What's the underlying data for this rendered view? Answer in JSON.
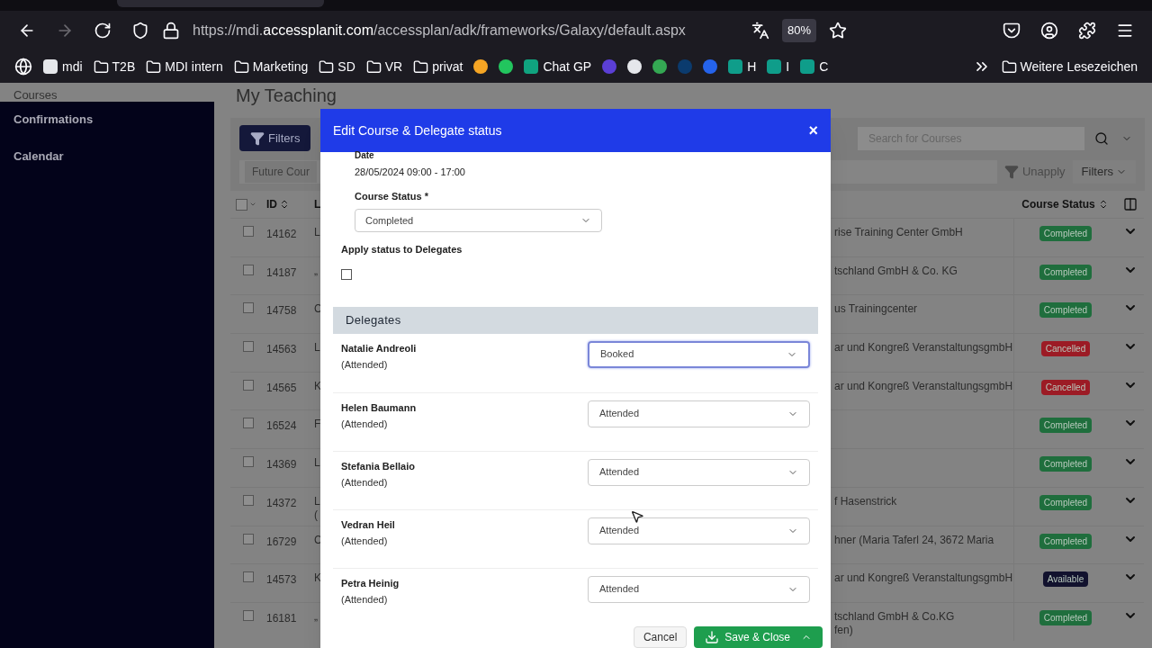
{
  "browser": {
    "url_start": "https://mdi.",
    "url_domain": "accessplanit.com",
    "url_path": "/accessplan/adk/frameworks/Galaxy/default.aspx",
    "zoom": "80%",
    "forward_disabled": true
  },
  "bookmarks": [
    {
      "kind": "site",
      "label": "mdi",
      "color": "#e5e7eb"
    },
    {
      "kind": "folder",
      "label": "T2B"
    },
    {
      "kind": "folder",
      "label": "MDI intern"
    },
    {
      "kind": "folder",
      "label": "Marketing"
    },
    {
      "kind": "folder",
      "label": "SD"
    },
    {
      "kind": "folder",
      "label": "VR"
    },
    {
      "kind": "folder",
      "label": "privat"
    },
    {
      "kind": "icon",
      "color": "#f5a524"
    },
    {
      "kind": "icon",
      "color": "#22c55e"
    },
    {
      "kind": "site",
      "label": "Chat GP",
      "color": "#10a37f"
    },
    {
      "kind": "icon",
      "color": "#5b3fd6"
    },
    {
      "kind": "icon",
      "color": "#e5e7eb"
    },
    {
      "kind": "icon",
      "color": "#34a853"
    },
    {
      "kind": "icon",
      "color": "#0b3b6e"
    },
    {
      "kind": "icon",
      "color": "#2563eb"
    },
    {
      "kind": "site",
      "label": "H",
      "color": "#0f9d8a"
    },
    {
      "kind": "site",
      "label": "I",
      "color": "#0f9d8a"
    },
    {
      "kind": "site",
      "label": "C",
      "color": "#0f9d8a"
    }
  ],
  "bookmarks_more": "Weitere Lesezeichen",
  "sidebar": {
    "items": [
      "Courses",
      "Confirmations",
      "Calendar"
    ]
  },
  "page_title": "My Teaching",
  "toolbar": {
    "filters_button": "Filters",
    "search_placeholder": "Search for Courses",
    "chip": "Future Cour",
    "unapply": "Unapply",
    "filters_menu": "Filters"
  },
  "table": {
    "select_all_checked": false,
    "columns": [
      "ID",
      "L",
      "Course Status"
    ],
    "rows": [
      {
        "checked": false,
        "id": "14162",
        "column_3": [
          "L"
        ],
        "column_4": [
          "rise Training Center GmbH"
        ],
        "status": "Completed",
        "color": "#1f6e3d"
      },
      {
        "checked": false,
        "id": "14187",
        "column_3": [
          "„"
        ],
        "column_4": [
          "tschland GmbH & Co. KG"
        ],
        "status": "Completed",
        "color": "#1f6e3d"
      },
      {
        "checked": false,
        "id": "14758",
        "column_3": [
          "C"
        ],
        "column_4": [
          "us Trainingcenter"
        ],
        "status": "Completed",
        "color": "#1f6e3d"
      },
      {
        "checked": false,
        "id": "14563",
        "column_3": [
          "L"
        ],
        "column_4": [
          "ar und Kongreß VeranstaltungsgmbH"
        ],
        "status": "Cancelled",
        "color": "#9c1b25"
      },
      {
        "checked": false,
        "id": "14565",
        "column_3": [
          "K"
        ],
        "column_4": [
          "ar und Kongreß VeranstaltungsgmbH"
        ],
        "status": "Cancelled",
        "color": "#9c1b25"
      },
      {
        "checked": false,
        "id": "16524",
        "column_3": [
          "F"
        ],
        "column_4": [],
        "status": "Completed",
        "color": "#1f6e3d"
      },
      {
        "checked": false,
        "id": "14369",
        "column_3": [
          "L"
        ],
        "column_4": [],
        "status": "Completed",
        "color": "#1f6e3d"
      },
      {
        "checked": false,
        "id": "14372",
        "column_3": [
          "L",
          "("
        ],
        "column_4": [
          "f Hasenstrick"
        ],
        "status": "Completed",
        "color": "#1f6e3d"
      },
      {
        "checked": false,
        "id": "16729",
        "column_3": [
          "C"
        ],
        "column_4": [
          "hner (Maria Taferl 24, 3672 Maria"
        ],
        "status": "Completed",
        "color": "#1f6e3d"
      },
      {
        "checked": false,
        "id": "14573",
        "column_3": [
          "K"
        ],
        "column_4": [
          "ar und Kongreß VeranstaltungsgmbH"
        ],
        "status": "Available",
        "color": "#12122e"
      },
      {
        "checked": false,
        "id": "16181",
        "column_3": [
          "„"
        ],
        "column_4": [
          "tschland GmbH & Co.KG",
          "fen)"
        ],
        "status": "Completed",
        "color": "#1f6e3d"
      }
    ]
  },
  "dialog": {
    "title": "Edit Course & Delegate status",
    "close": "×",
    "date_label": "Date",
    "date": "28/05/2024 09:00 - 17:00",
    "course_status_label": "Course Status *",
    "course_status": "Completed",
    "apply_label": "Apply status to Delegates",
    "apply_checked": false,
    "delegates_heading": "Delegates",
    "delegates": [
      {
        "name": "Natalie Andreoli",
        "note": "(Attended)",
        "status": "Booked",
        "selected": true
      },
      {
        "name": "Helen Baumann",
        "note": "(Attended)",
        "status": "Attended",
        "selected": false
      },
      {
        "name": "Stefania Bellaio",
        "note": "(Attended)",
        "status": "Attended",
        "selected": false
      },
      {
        "name": "Vedran Heil",
        "note": "(Attended)",
        "status": "Attended",
        "selected": false
      },
      {
        "name": "Petra Heinig",
        "note": "(Attended)",
        "status": "Attended",
        "selected": false
      }
    ],
    "cancel": "Cancel",
    "save": "Save & Close"
  }
}
